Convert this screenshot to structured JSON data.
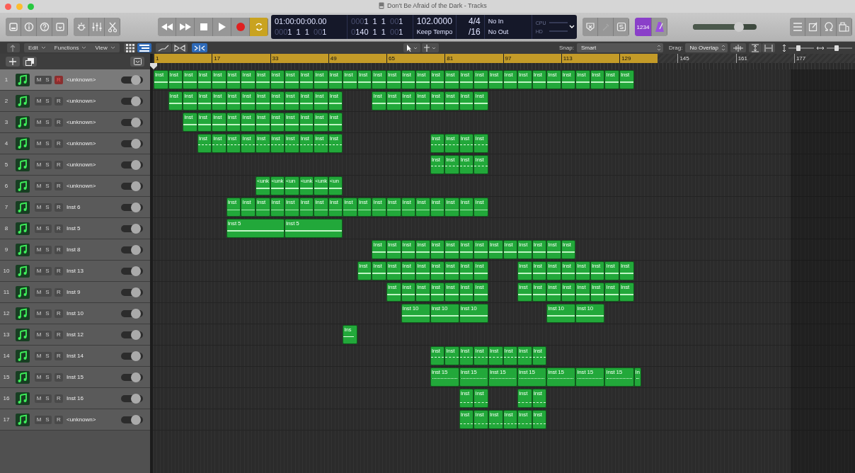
{
  "window": {
    "title": "Don't Be Afraid of the Dark - Tracks"
  },
  "lcd": {
    "time": "01:00:00:00.00",
    "position": [
      {
        "text": "000",
        "dim": true
      },
      {
        "text": "1  1  1  ",
        "dim": false
      },
      {
        "text": "00",
        "dim": true
      },
      {
        "text": "1",
        "dim": false
      }
    ],
    "end_position": [
      {
        "text": "000",
        "dim": true
      },
      {
        "text": "1  1  1  ",
        "dim": false
      },
      {
        "text": "00",
        "dim": true
      },
      {
        "text": "1",
        "dim": false
      }
    ],
    "bars": [
      {
        "text": "0",
        "dim": true
      },
      {
        "text": "140  1  1  ",
        "dim": false
      },
      {
        "text": "00",
        "dim": true
      },
      {
        "text": "1",
        "dim": false
      }
    ],
    "tempo": "102.0000",
    "tempo_mode": "Keep Tempo",
    "signature": "4/4",
    "division": "/16",
    "midi_in": "No In",
    "midi_out": "No Out",
    "meters": [
      "CPU",
      "HD"
    ]
  },
  "transport": {
    "cycle_on": true
  },
  "count_in": "1234",
  "master_volume": {
    "level": 0.72
  },
  "menus": [
    "Edit",
    "Functions",
    "View"
  ],
  "view_buttons": [
    {
      "selected": false
    },
    {
      "selected": true
    }
  ],
  "catch_on": true,
  "snap": {
    "label": "Snap:",
    "value": "Smart"
  },
  "drag": {
    "label": "Drag:",
    "value": "No Overlap"
  },
  "zoom_sliders": [
    {
      "level": 0.4
    },
    {
      "level": 0.4
    }
  ],
  "ruler": [
    "1",
    "17",
    "33",
    "49",
    "65",
    "81",
    "97",
    "113",
    "129",
    "145",
    "161",
    "177"
  ],
  "tracks": [
    {
      "number": "1",
      "name": "<unknown>",
      "selected": true,
      "mute": "M",
      "solo": "S",
      "record": "R",
      "armed": true,
      "on": true,
      "kind": "solid",
      "regions": [
        {
          "kind": "single",
          "label": "Inst"
        },
        {
          "kind": "single",
          "label": "Inst"
        },
        {
          "kind": "single",
          "label": "Inst"
        },
        {
          "kind": "single",
          "label": "Inst"
        },
        {
          "kind": "single",
          "label": "Inst"
        },
        {
          "kind": "single",
          "label": "Inst"
        },
        {
          "kind": "single",
          "label": "Inst"
        },
        {
          "kind": "single",
          "label": "Inst"
        },
        {
          "kind": "single",
          "label": "Inst"
        },
        {
          "kind": "single",
          "label": "Inst"
        },
        {
          "kind": "single",
          "label": "Inst"
        },
        {
          "kind": "single",
          "label": "Inst"
        },
        {
          "kind": "single",
          "label": "Inst"
        },
        {
          "kind": "single",
          "label": "Inst"
        },
        {
          "kind": "single",
          "label": "Inst"
        },
        {
          "kind": "single",
          "label": "Inst"
        },
        {
          "kind": "single",
          "label": "Inst"
        },
        {
          "kind": "single",
          "label": "Inst"
        },
        {
          "kind": "single",
          "label": "Inst"
        },
        {
          "kind": "single",
          "label": "Inst"
        },
        {
          "kind": "single",
          "label": "Inst"
        },
        {
          "kind": "single",
          "label": "Inst"
        },
        {
          "kind": "single",
          "label": "Inst"
        },
        {
          "kind": "single",
          "label": "Inst"
        },
        {
          "kind": "single",
          "label": "Inst"
        },
        {
          "kind": "single",
          "label": "Inst"
        },
        {
          "kind": "single",
          "label": "Inst"
        },
        {
          "kind": "single",
          "label": "Inst"
        },
        {
          "kind": "single",
          "label": "Inst"
        },
        {
          "kind": "single",
          "label": "Inst"
        },
        {
          "kind": "single",
          "label": "Inst"
        },
        {
          "kind": "single",
          "label": "Inst"
        },
        {
          "kind": "single",
          "label": "Inst"
        }
      ]
    },
    {
      "number": "2",
      "name": "<unknown>",
      "selected": false,
      "mute": "M",
      "solo": "S",
      "record": "R",
      "armed": false,
      "on": true,
      "kind": "solid",
      "regions": [
        {
          "kind": "gap"
        },
        {
          "kind": "single",
          "label": "Inst"
        },
        {
          "kind": "single",
          "label": "Inst"
        },
        {
          "kind": "single",
          "label": "Inst"
        },
        {
          "kind": "single",
          "label": "Inst"
        },
        {
          "kind": "single",
          "label": "Inst"
        },
        {
          "kind": "single",
          "label": "Inst"
        },
        {
          "kind": "single",
          "label": "Inst"
        },
        {
          "kind": "single",
          "label": "Inst"
        },
        {
          "kind": "single",
          "label": "Inst"
        },
        {
          "kind": "single",
          "label": "Inst"
        },
        {
          "kind": "single",
          "label": "Inst"
        },
        {
          "kind": "single",
          "label": "Inst"
        },
        {
          "kind": "gap"
        },
        {
          "kind": "gap"
        },
        {
          "kind": "single",
          "label": "Inst"
        },
        {
          "kind": "single",
          "label": "Inst"
        },
        {
          "kind": "single",
          "label": "Inst"
        },
        {
          "kind": "single",
          "label": "Inst"
        },
        {
          "kind": "single",
          "label": "Inst"
        },
        {
          "kind": "single",
          "label": "Inst"
        },
        {
          "kind": "single",
          "label": "Inst"
        },
        {
          "kind": "single",
          "label": "Inst"
        }
      ]
    },
    {
      "number": "3",
      "name": "<unknown>",
      "selected": false,
      "mute": "M",
      "solo": "S",
      "record": "R",
      "armed": false,
      "on": true,
      "kind": "solid",
      "regions": [
        {
          "kind": "gap"
        },
        {
          "kind": "gap"
        },
        {
          "kind": "single",
          "label": "Inst"
        },
        {
          "kind": "single",
          "label": "Inst"
        },
        {
          "kind": "single",
          "label": "Inst"
        },
        {
          "kind": "single",
          "label": "Inst"
        },
        {
          "kind": "single",
          "label": "Inst"
        },
        {
          "kind": "single",
          "label": "Inst"
        },
        {
          "kind": "single",
          "label": "Inst"
        },
        {
          "kind": "single",
          "label": "Inst"
        },
        {
          "kind": "single",
          "label": "Inst"
        },
        {
          "kind": "single",
          "label": "Inst"
        },
        {
          "kind": "single",
          "label": "Inst"
        }
      ]
    },
    {
      "number": "4",
      "name": "<unknown>",
      "selected": false,
      "mute": "M",
      "solo": "S",
      "record": "R",
      "armed": false,
      "on": true,
      "kind": "dashed",
      "regions": [
        {
          "kind": "gap"
        },
        {
          "kind": "gap"
        },
        {
          "kind": "gap"
        },
        {
          "kind": "single",
          "label": "Inst"
        },
        {
          "kind": "single",
          "label": "Inst"
        },
        {
          "kind": "single",
          "label": "Inst"
        },
        {
          "kind": "single",
          "label": "Inst"
        },
        {
          "kind": "single",
          "label": "Inst"
        },
        {
          "kind": "single",
          "label": "Inst"
        },
        {
          "kind": "single",
          "label": "Inst"
        },
        {
          "kind": "single",
          "label": "Inst"
        },
        {
          "kind": "single",
          "label": "Inst"
        },
        {
          "kind": "single",
          "label": "Inst"
        },
        {
          "kind": "gap"
        },
        {
          "kind": "gap"
        },
        {
          "kind": "gap"
        },
        {
          "kind": "gap"
        },
        {
          "kind": "gap"
        },
        {
          "kind": "gap"
        },
        {
          "kind": "single",
          "label": "Inst"
        },
        {
          "kind": "single",
          "label": "Inst"
        },
        {
          "kind": "single",
          "label": "Inst"
        },
        {
          "kind": "single",
          "label": "Inst"
        }
      ]
    },
    {
      "number": "5",
      "name": "<unknown>",
      "selected": false,
      "mute": "M",
      "solo": "S",
      "record": "R",
      "armed": false,
      "on": true,
      "kind": "dashed",
      "regions": [
        {
          "kind": "gap"
        },
        {
          "kind": "gap"
        },
        {
          "kind": "gap"
        },
        {
          "kind": "gap"
        },
        {
          "kind": "gap"
        },
        {
          "kind": "gap"
        },
        {
          "kind": "gap"
        },
        {
          "kind": "gap"
        },
        {
          "kind": "gap"
        },
        {
          "kind": "gap"
        },
        {
          "kind": "gap"
        },
        {
          "kind": "gap"
        },
        {
          "kind": "gap"
        },
        {
          "kind": "gap"
        },
        {
          "kind": "gap"
        },
        {
          "kind": "gap"
        },
        {
          "kind": "gap"
        },
        {
          "kind": "gap"
        },
        {
          "kind": "gap"
        },
        {
          "kind": "single",
          "label": "Inst"
        },
        {
          "kind": "single",
          "label": "Inst"
        },
        {
          "kind": "single",
          "label": "Inst"
        },
        {
          "kind": "single",
          "label": "Inst"
        }
      ]
    },
    {
      "number": "6",
      "name": "<unknown>",
      "selected": false,
      "mute": "M",
      "solo": "S",
      "record": "R",
      "armed": false,
      "on": true,
      "kind": "solid",
      "regions": [
        {
          "kind": "gap"
        },
        {
          "kind": "gap"
        },
        {
          "kind": "gap"
        },
        {
          "kind": "gap"
        },
        {
          "kind": "gap"
        },
        {
          "kind": "gap"
        },
        {
          "kind": "gap"
        },
        {
          "kind": "single",
          "label": "<unk"
        },
        {
          "kind": "single",
          "label": "<unk"
        },
        {
          "kind": "single",
          "label": "<un"
        },
        {
          "kind": "single",
          "label": "<unk"
        },
        {
          "kind": "single",
          "label": "<unk"
        },
        {
          "kind": "single",
          "label": "<un"
        }
      ]
    },
    {
      "number": "7",
      "name": "Inst 6",
      "selected": false,
      "mute": "M",
      "solo": "S",
      "record": "R",
      "armed": false,
      "on": true,
      "kind": "wave",
      "regions": [
        {
          "kind": "gap"
        },
        {
          "kind": "gap"
        },
        {
          "kind": "gap"
        },
        {
          "kind": "gap"
        },
        {
          "kind": "gap"
        },
        {
          "kind": "single",
          "label": "Inst"
        },
        {
          "kind": "single",
          "label": "Inst"
        },
        {
          "kind": "single",
          "label": "Inst"
        },
        {
          "kind": "single",
          "label": "Inst"
        },
        {
          "kind": "single",
          "label": "Inst"
        },
        {
          "kind": "single",
          "label": "Inst"
        },
        {
          "kind": "single",
          "label": "Inst"
        },
        {
          "kind": "single",
          "label": "Inst"
        },
        {
          "kind": "single",
          "label": "Inst"
        },
        {
          "kind": "single",
          "label": "Inst"
        },
        {
          "kind": "single",
          "label": "Inst"
        },
        {
          "kind": "single",
          "label": "Inst"
        },
        {
          "kind": "single",
          "label": "Inst"
        },
        {
          "kind": "single",
          "label": "Inst"
        },
        {
          "kind": "single",
          "label": "Inst"
        },
        {
          "kind": "single",
          "label": "Inst"
        },
        {
          "kind": "single",
          "label": "Inst"
        },
        {
          "kind": "single",
          "label": "Inst"
        }
      ]
    },
    {
      "number": "8",
      "name": "Inst 5",
      "selected": false,
      "mute": "M",
      "solo": "S",
      "record": "R",
      "armed": false,
      "on": true,
      "kind": "solid",
      "regions": [
        {
          "kind": "gap"
        },
        {
          "kind": "gap"
        },
        {
          "kind": "gap"
        },
        {
          "kind": "gap"
        },
        {
          "kind": "gap"
        },
        {
          "kind": "quad",
          "label": "Inst 5"
        },
        {
          "kind": "quad",
          "label": "Inst 5"
        }
      ]
    },
    {
      "number": "9",
      "name": "Inst 8",
      "selected": false,
      "mute": "M",
      "solo": "S",
      "record": "R",
      "armed": false,
      "on": true,
      "kind": "solid",
      "regions": [
        {
          "kind": "gap"
        },
        {
          "kind": "gap"
        },
        {
          "kind": "gap"
        },
        {
          "kind": "gap"
        },
        {
          "kind": "gap"
        },
        {
          "kind": "gap"
        },
        {
          "kind": "gap"
        },
        {
          "kind": "gap"
        },
        {
          "kind": "gap"
        },
        {
          "kind": "gap"
        },
        {
          "kind": "gap"
        },
        {
          "kind": "gap"
        },
        {
          "kind": "gap"
        },
        {
          "kind": "gap"
        },
        {
          "kind": "gap"
        },
        {
          "kind": "single",
          "label": "Inst"
        },
        {
          "kind": "single",
          "label": "Inst"
        },
        {
          "kind": "single",
          "label": "Inst"
        },
        {
          "kind": "single",
          "label": "Inst"
        },
        {
          "kind": "single",
          "label": "Inst"
        },
        {
          "kind": "single",
          "label": "Inst"
        },
        {
          "kind": "single",
          "label": "Inst"
        },
        {
          "kind": "single",
          "label": "Inst"
        },
        {
          "kind": "single",
          "label": "Inst"
        },
        {
          "kind": "single",
          "label": "Inst"
        },
        {
          "kind": "single",
          "label": "Inst"
        },
        {
          "kind": "single",
          "label": "Inst"
        },
        {
          "kind": "single",
          "label": "Inst"
        },
        {
          "kind": "single",
          "label": "Inst"
        }
      ]
    },
    {
      "number": "10",
      "name": "Inst 13",
      "selected": false,
      "mute": "M",
      "solo": "S",
      "record": "R",
      "armed": false,
      "on": true,
      "kind": "solid",
      "regions": [
        {
          "kind": "gap"
        },
        {
          "kind": "gap"
        },
        {
          "kind": "gap"
        },
        {
          "kind": "gap"
        },
        {
          "kind": "gap"
        },
        {
          "kind": "gap"
        },
        {
          "kind": "gap"
        },
        {
          "kind": "gap"
        },
        {
          "kind": "gap"
        },
        {
          "kind": "gap"
        },
        {
          "kind": "gap"
        },
        {
          "kind": "gap"
        },
        {
          "kind": "gap"
        },
        {
          "kind": "gap"
        },
        {
          "kind": "single",
          "label": "Inst"
        },
        {
          "kind": "single",
          "label": "Inst"
        },
        {
          "kind": "single",
          "label": "Inst"
        },
        {
          "kind": "single",
          "label": "Inst"
        },
        {
          "kind": "single",
          "label": "Inst"
        },
        {
          "kind": "single",
          "label": "Inst"
        },
        {
          "kind": "single",
          "label": "Inst"
        },
        {
          "kind": "single",
          "label": "Inst"
        },
        {
          "kind": "single",
          "label": "Inst"
        },
        {
          "kind": "gap"
        },
        {
          "kind": "gap"
        },
        {
          "kind": "single",
          "label": "Inst"
        },
        {
          "kind": "single",
          "label": "Inst"
        },
        {
          "kind": "single",
          "label": "Inst"
        },
        {
          "kind": "single",
          "label": "Inst"
        },
        {
          "kind": "single",
          "label": "Inst"
        },
        {
          "kind": "single",
          "label": "Inst"
        },
        {
          "kind": "single",
          "label": "Inst"
        },
        {
          "kind": "single",
          "label": "Inst"
        }
      ]
    },
    {
      "number": "11",
      "name": "Inst 9",
      "selected": false,
      "mute": "M",
      "solo": "S",
      "record": "R",
      "armed": false,
      "on": true,
      "kind": "solid",
      "regions": [
        {
          "kind": "gap"
        },
        {
          "kind": "gap"
        },
        {
          "kind": "gap"
        },
        {
          "kind": "gap"
        },
        {
          "kind": "gap"
        },
        {
          "kind": "gap"
        },
        {
          "kind": "gap"
        },
        {
          "kind": "gap"
        },
        {
          "kind": "gap"
        },
        {
          "kind": "gap"
        },
        {
          "kind": "gap"
        },
        {
          "kind": "gap"
        },
        {
          "kind": "gap"
        },
        {
          "kind": "gap"
        },
        {
          "kind": "gap"
        },
        {
          "kind": "gap"
        },
        {
          "kind": "single",
          "label": "Inst"
        },
        {
          "kind": "single",
          "label": "Inst"
        },
        {
          "kind": "single",
          "label": "Inst"
        },
        {
          "kind": "single",
          "label": "Inst"
        },
        {
          "kind": "single",
          "label": "Inst"
        },
        {
          "kind": "single",
          "label": "Inst"
        },
        {
          "kind": "single",
          "label": "Inst"
        },
        {
          "kind": "gap"
        },
        {
          "kind": "gap"
        },
        {
          "kind": "single",
          "label": "Inst"
        },
        {
          "kind": "single",
          "label": "Inst"
        },
        {
          "kind": "single",
          "label": "Inst"
        },
        {
          "kind": "single",
          "label": "Inst"
        },
        {
          "kind": "single",
          "label": "Inst"
        },
        {
          "kind": "single",
          "label": "Inst"
        },
        {
          "kind": "single",
          "label": "Inst"
        },
        {
          "kind": "single",
          "label": "Inst"
        }
      ]
    },
    {
      "number": "12",
      "name": "Inst 10",
      "selected": false,
      "mute": "M",
      "solo": "S",
      "record": "R",
      "armed": false,
      "on": true,
      "kind": "solid",
      "regions": [
        {
          "kind": "gap"
        },
        {
          "kind": "gap"
        },
        {
          "kind": "gap"
        },
        {
          "kind": "gap"
        },
        {
          "kind": "gap"
        },
        {
          "kind": "gap"
        },
        {
          "kind": "gap"
        },
        {
          "kind": "gap"
        },
        {
          "kind": "gap"
        },
        {
          "kind": "gap"
        },
        {
          "kind": "gap"
        },
        {
          "kind": "gap"
        },
        {
          "kind": "gap"
        },
        {
          "kind": "gap"
        },
        {
          "kind": "gap"
        },
        {
          "kind": "gap"
        },
        {
          "kind": "gap"
        },
        {
          "kind": "double",
          "label": "Inst 10"
        },
        {
          "kind": "double",
          "label": "Inst 10"
        },
        {
          "kind": "double",
          "label": "Inst 10"
        },
        {
          "kind": "gap"
        },
        {
          "kind": "gap"
        },
        {
          "kind": "gap"
        },
        {
          "kind": "gap"
        },
        {
          "kind": "double",
          "label": "Inst 10"
        },
        {
          "kind": "double",
          "label": "Inst 10"
        }
      ]
    },
    {
      "number": "13",
      "name": "Inst 12",
      "selected": false,
      "mute": "M",
      "solo": "S",
      "record": "R",
      "armed": false,
      "on": true,
      "kind": "short",
      "regions": [
        {
          "kind": "gap"
        },
        {
          "kind": "gap"
        },
        {
          "kind": "gap"
        },
        {
          "kind": "gap"
        },
        {
          "kind": "gap"
        },
        {
          "kind": "gap"
        },
        {
          "kind": "gap"
        },
        {
          "kind": "gap"
        },
        {
          "kind": "gap"
        },
        {
          "kind": "gap"
        },
        {
          "kind": "gap"
        },
        {
          "kind": "gap"
        },
        {
          "kind": "gap"
        },
        {
          "kind": "single",
          "label": "Ins"
        }
      ]
    },
    {
      "number": "14",
      "name": "Inst 14",
      "selected": false,
      "mute": "M",
      "solo": "S",
      "record": "R",
      "armed": false,
      "on": true,
      "kind": "dashed",
      "regions": [
        {
          "kind": "gap"
        },
        {
          "kind": "gap"
        },
        {
          "kind": "gap"
        },
        {
          "kind": "gap"
        },
        {
          "kind": "gap"
        },
        {
          "kind": "gap"
        },
        {
          "kind": "gap"
        },
        {
          "kind": "gap"
        },
        {
          "kind": "gap"
        },
        {
          "kind": "gap"
        },
        {
          "kind": "gap"
        },
        {
          "kind": "gap"
        },
        {
          "kind": "gap"
        },
        {
          "kind": "gap"
        },
        {
          "kind": "gap"
        },
        {
          "kind": "gap"
        },
        {
          "kind": "gap"
        },
        {
          "kind": "gap"
        },
        {
          "kind": "gap"
        },
        {
          "kind": "single",
          "label": "Inst"
        },
        {
          "kind": "single",
          "label": "Inst"
        },
        {
          "kind": "single",
          "label": "Inst"
        },
        {
          "kind": "single",
          "label": "Inst"
        },
        {
          "kind": "single",
          "label": "Inst"
        },
        {
          "kind": "single",
          "label": "Inst"
        },
        {
          "kind": "single",
          "label": "Inst"
        },
        {
          "kind": "single",
          "label": "Inst"
        }
      ]
    },
    {
      "number": "15",
      "name": "Inst 15",
      "selected": false,
      "mute": "M",
      "solo": "S",
      "record": "R",
      "armed": false,
      "on": true,
      "kind": "dotted",
      "regions": [
        {
          "kind": "gap"
        },
        {
          "kind": "gap"
        },
        {
          "kind": "gap"
        },
        {
          "kind": "gap"
        },
        {
          "kind": "gap"
        },
        {
          "kind": "gap"
        },
        {
          "kind": "gap"
        },
        {
          "kind": "gap"
        },
        {
          "kind": "gap"
        },
        {
          "kind": "gap"
        },
        {
          "kind": "gap"
        },
        {
          "kind": "gap"
        },
        {
          "kind": "gap"
        },
        {
          "kind": "gap"
        },
        {
          "kind": "gap"
        },
        {
          "kind": "gap"
        },
        {
          "kind": "gap"
        },
        {
          "kind": "gap"
        },
        {
          "kind": "gap"
        },
        {
          "kind": "double",
          "label": "Inst 15"
        },
        {
          "kind": "double",
          "label": "Inst 15"
        },
        {
          "kind": "double",
          "label": "Inst 15"
        },
        {
          "kind": "double",
          "label": "Inst 15"
        },
        {
          "kind": "double",
          "label": "Inst 15"
        },
        {
          "kind": "double",
          "label": "Inst 15"
        },
        {
          "kind": "double",
          "label": "Inst 15"
        },
        {
          "kind": "half",
          "label": "In"
        }
      ]
    },
    {
      "number": "16",
      "name": "Inst 16",
      "selected": false,
      "mute": "M",
      "solo": "S",
      "record": "R",
      "armed": false,
      "on": true,
      "kind": "dense",
      "regions": [
        {
          "kind": "gap"
        },
        {
          "kind": "gap"
        },
        {
          "kind": "gap"
        },
        {
          "kind": "gap"
        },
        {
          "kind": "gap"
        },
        {
          "kind": "gap"
        },
        {
          "kind": "gap"
        },
        {
          "kind": "gap"
        },
        {
          "kind": "gap"
        },
        {
          "kind": "gap"
        },
        {
          "kind": "gap"
        },
        {
          "kind": "gap"
        },
        {
          "kind": "gap"
        },
        {
          "kind": "gap"
        },
        {
          "kind": "gap"
        },
        {
          "kind": "gap"
        },
        {
          "kind": "gap"
        },
        {
          "kind": "gap"
        },
        {
          "kind": "gap"
        },
        {
          "kind": "gap"
        },
        {
          "kind": "gap"
        },
        {
          "kind": "single",
          "label": "Inst"
        },
        {
          "kind": "single",
          "label": "Inst"
        },
        {
          "kind": "gap"
        },
        {
          "kind": "gap"
        },
        {
          "kind": "single",
          "label": "Inst"
        },
        {
          "kind": "single",
          "label": "Inst"
        }
      ]
    },
    {
      "number": "17",
      "name": "<unknown>",
      "selected": false,
      "mute": "M",
      "solo": "S",
      "record": "R",
      "armed": false,
      "on": true,
      "kind": "dense",
      "regions": [
        {
          "kind": "gap"
        },
        {
          "kind": "gap"
        },
        {
          "kind": "gap"
        },
        {
          "kind": "gap"
        },
        {
          "kind": "gap"
        },
        {
          "kind": "gap"
        },
        {
          "kind": "gap"
        },
        {
          "kind": "gap"
        },
        {
          "kind": "gap"
        },
        {
          "kind": "gap"
        },
        {
          "kind": "gap"
        },
        {
          "kind": "gap"
        },
        {
          "kind": "gap"
        },
        {
          "kind": "gap"
        },
        {
          "kind": "gap"
        },
        {
          "kind": "gap"
        },
        {
          "kind": "gap"
        },
        {
          "kind": "gap"
        },
        {
          "kind": "gap"
        },
        {
          "kind": "gap"
        },
        {
          "kind": "gap"
        },
        {
          "kind": "single",
          "label": "Inst"
        },
        {
          "kind": "single",
          "label": "Inst"
        },
        {
          "kind": "single",
          "label": "Inst"
        },
        {
          "kind": "single",
          "label": "Inst"
        },
        {
          "kind": "single",
          "label": "Inst"
        },
        {
          "kind": "single",
          "label": "Inst"
        }
      ]
    }
  ]
}
